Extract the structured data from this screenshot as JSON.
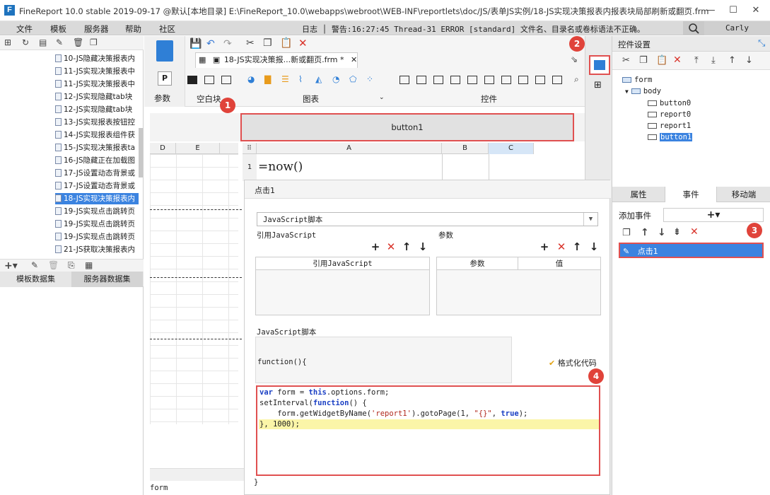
{
  "window": {
    "title": "FineReport 10.0 stable 2019-09-17 @默认[本地目录]   E:\\FineReport_10.0\\webapps\\webroot\\WEB-INF\\reportlets\\doc/JS/表单JS实例/18-JS实现决策报表内报表块局部刷新或翻页.frm",
    "logo_text": "F",
    "minimize": "—",
    "maximize": "☐",
    "close": "✕"
  },
  "menu": {
    "items": [
      "文件",
      "模板",
      "服务器",
      "帮助",
      "社区"
    ],
    "log": "日志 │ 警告:16:27:45 Thread-31 ERROR [standard] 文件名、目录名或卷标语法不正确。",
    "user": "Carly"
  },
  "template_tree": {
    "items": [
      "10-JS隐藏决策报表内",
      "11-JS实现决策报表中",
      "11-JS实现决策报表中",
      "12-JS实现隐藏tab块",
      "12-JS实现隐藏tab块",
      "13-JS实现报表按钮控",
      "14-JS实现报表组件获",
      "15-JS实现决策报表ta",
      "16-JS隐藏正在加载图",
      "17-JS设置动态背景或",
      "17-JS设置动态背景或",
      "18-JS实现决策报表内",
      "19-JS实现点击跳转页",
      "19-JS实现点击跳转页",
      "19-JS实现点击跳转页",
      "21-JS获取决策报表内"
    ],
    "selected_index": 11
  },
  "dataset_tabs": [
    "模板数据集",
    "服务器数据集"
  ],
  "document_tab": {
    "label": "18-JS实现决策报...新或翻页.frm *",
    "close": "✕"
  },
  "ribbon": {
    "groups": [
      "参数",
      "空白块",
      "图表",
      "控件"
    ]
  },
  "canvas": {
    "button1_label": "button1",
    "left_columns": [
      "D",
      "E"
    ],
    "report_columns": [
      "A",
      "B",
      "C"
    ],
    "row_number": "1",
    "cell_formula": "=now()",
    "status_label": "form"
  },
  "event_dialog": {
    "title": "点击1",
    "script_type": "JavaScript脚本",
    "ref_js_label": "引用JavaScript",
    "params_label": "参数",
    "ref_js_header": "引用JavaScript",
    "params_header_param": "参数",
    "params_header_value": "值",
    "js_script_label": "JavaScript脚本",
    "function_signature": "function(){",
    "format_code": "格式化代码",
    "closing_brace": "}",
    "code": {
      "l1_kw1": "var",
      "l1_mid": " form = ",
      "l1_kw2": "this",
      "l1_end": ".options.form;",
      "l2_start": "setInterval(",
      "l2_kw": "function",
      "l2_end": "() {",
      "l3_start": "    form.getWidgetByName(",
      "l3_str1": "'report1'",
      "l3_mid": ").gotoPage(1, ",
      "l3_str2": "\"{}\"",
      "l3_mid2": ", ",
      "l3_kw": "true",
      "l3_end": ");",
      "l4": "}, 1000);"
    }
  },
  "widget_settings": {
    "title": "控件设置",
    "tree": {
      "root": "form",
      "body": "body",
      "children": [
        "button0",
        "report0",
        "report1",
        "button1"
      ],
      "selected": "button1"
    },
    "tabs": [
      "属性",
      "事件",
      "移动端"
    ],
    "active_tab": "事件",
    "add_event_label": "添加事件",
    "add_button": "+▾",
    "event_item": "点击1"
  },
  "callouts": [
    "1",
    "2",
    "3",
    "4"
  ],
  "colors": {
    "highlight_red": "#e05050",
    "selection_blue": "#3b83e0"
  }
}
